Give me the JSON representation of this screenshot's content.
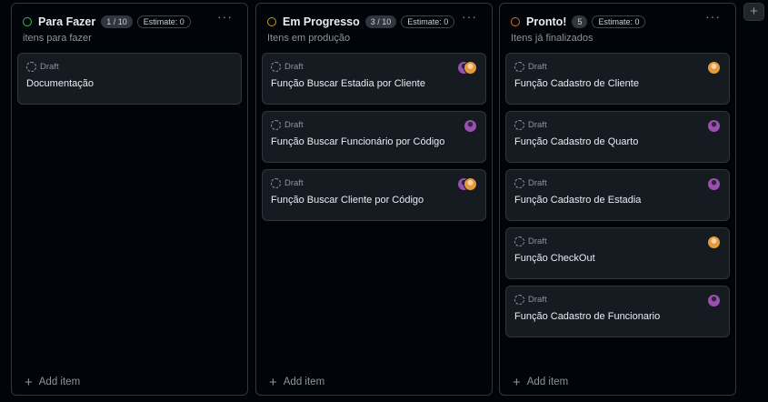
{
  "columns": [
    {
      "title": "Para Fazer",
      "count": "1 / 10",
      "estimate": "Estimate: 0",
      "description": "itens para fazer",
      "status_color": "#3fb950",
      "more": "···",
      "add_item": "Add item",
      "cards": [
        {
          "status": "Draft",
          "title": "Documentação",
          "assignees": []
        }
      ]
    },
    {
      "title": "Em Progresso",
      "count": "3 / 10",
      "estimate": "Estimate: 0",
      "description": "Itens em produção",
      "status_color": "#d29922",
      "more": "···",
      "add_item": "Add item",
      "cards": [
        {
          "status": "Draft",
          "title": "Função Buscar Estadia por Cliente",
          "assignees": [
            "purple-avatar",
            "orange-avatar"
          ]
        },
        {
          "status": "Draft",
          "title": "Função Buscar Funcionário por Código",
          "assignees": [
            "purple-avatar"
          ]
        },
        {
          "status": "Draft",
          "title": "Função Buscar Cliente por Código",
          "assignees": [
            "purple-avatar",
            "orange-avatar"
          ]
        }
      ]
    },
    {
      "title": "Pronto!",
      "count": "5",
      "estimate": "Estimate: 0",
      "description": "Itens já finalizados",
      "status_color": "#db6d28",
      "more": "···",
      "add_item": "Add item",
      "cards": [
        {
          "status": "Draft",
          "title": "Função Cadastro de Cliente",
          "assignees": [
            "orange-avatar"
          ]
        },
        {
          "status": "Draft",
          "title": "Função Cadastro de Quarto",
          "assignees": [
            "purple-avatar"
          ]
        },
        {
          "status": "Draft",
          "title": "Função Cadastro de Estadia",
          "assignees": [
            "purple-avatar"
          ]
        },
        {
          "status": "Draft",
          "title": "Função CheckOut",
          "assignees": [
            "orange-avatar"
          ]
        },
        {
          "status": "Draft",
          "title": "Função Cadastro de Funcionario",
          "assignees": [
            "purple-avatar"
          ]
        }
      ]
    }
  ],
  "add_column_label": "+"
}
